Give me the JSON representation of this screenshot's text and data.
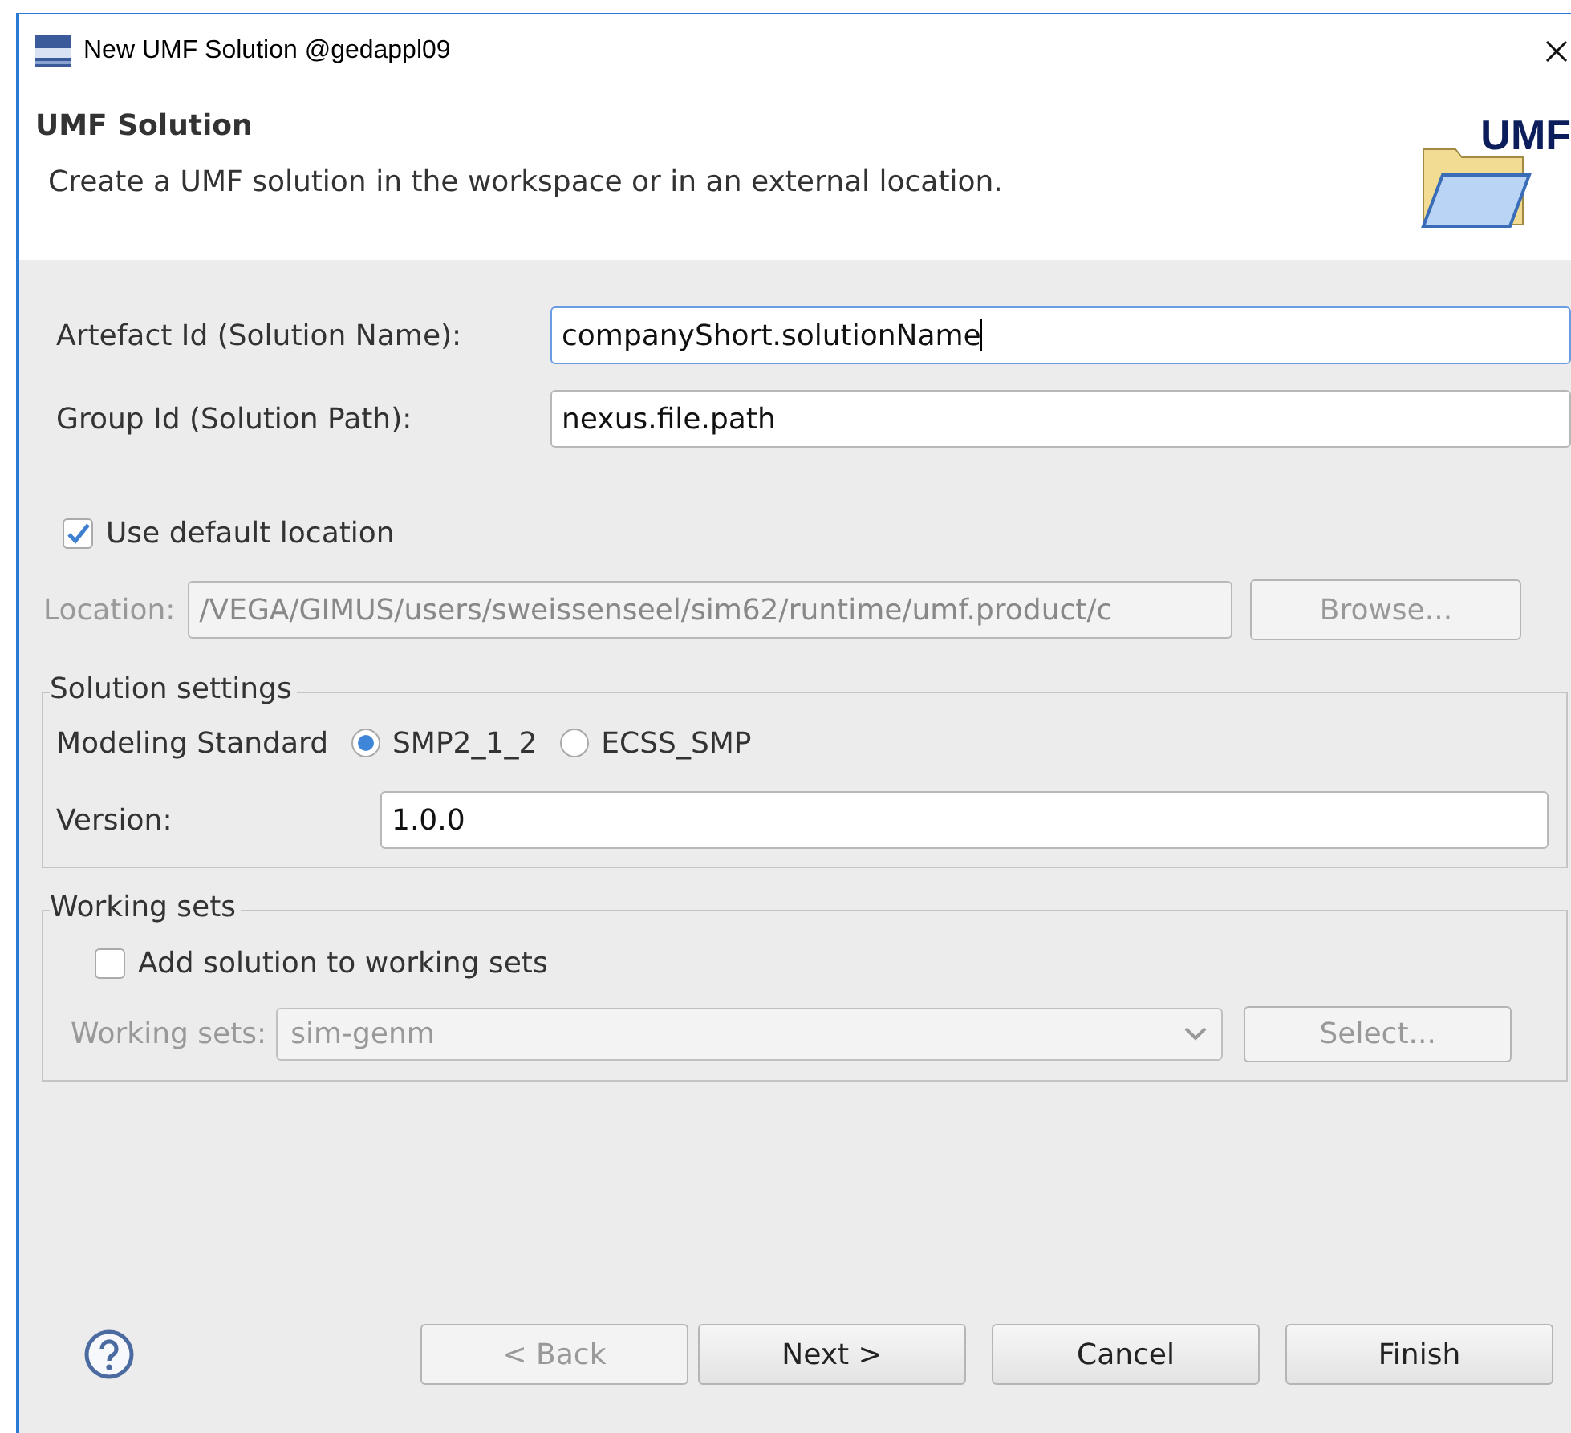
{
  "window": {
    "title": "New UMF Solution @gedappl09"
  },
  "header": {
    "title": "UMF Solution",
    "description": "Create a UMF solution in the workspace or in an external location.",
    "logo_text": "UMF"
  },
  "fields": [
    {
      "label": "Artefact Id (Solution Name):",
      "value": "companyShort.solutionName",
      "focused": true
    },
    {
      "label": "Group Id (Solution Path):",
      "value": "nexus.file.path",
      "focused": false
    }
  ],
  "use_default_location": {
    "label": "Use default location",
    "checked": true
  },
  "location": {
    "label": "Location:",
    "value": "/VEGA/GIMUS/users/sweissenseel/sim62/runtime/umf.product/c",
    "disabled": true,
    "button": "Browse..."
  },
  "solution_settings": {
    "title": "Solution settings",
    "modeling_label": "Modeling Standard",
    "options": [
      {
        "label": "SMP2_1_2",
        "selected": true
      },
      {
        "label": "ECSS_SMP",
        "selected": false
      }
    ],
    "version_label": "Version:",
    "version": "1.0.0"
  },
  "working_sets": {
    "title": "Working sets",
    "checkbox": {
      "label": "Add solution to working sets",
      "checked": false
    },
    "label": "Working sets:",
    "value": "sim-genm",
    "disabled": true,
    "button": "Select..."
  },
  "buttons": [
    {
      "label": "< Back",
      "disabled": true
    },
    {
      "label": "Next >",
      "disabled": false
    },
    {
      "label": "Cancel",
      "disabled": false
    },
    {
      "label": "Finish",
      "disabled": false
    }
  ]
}
